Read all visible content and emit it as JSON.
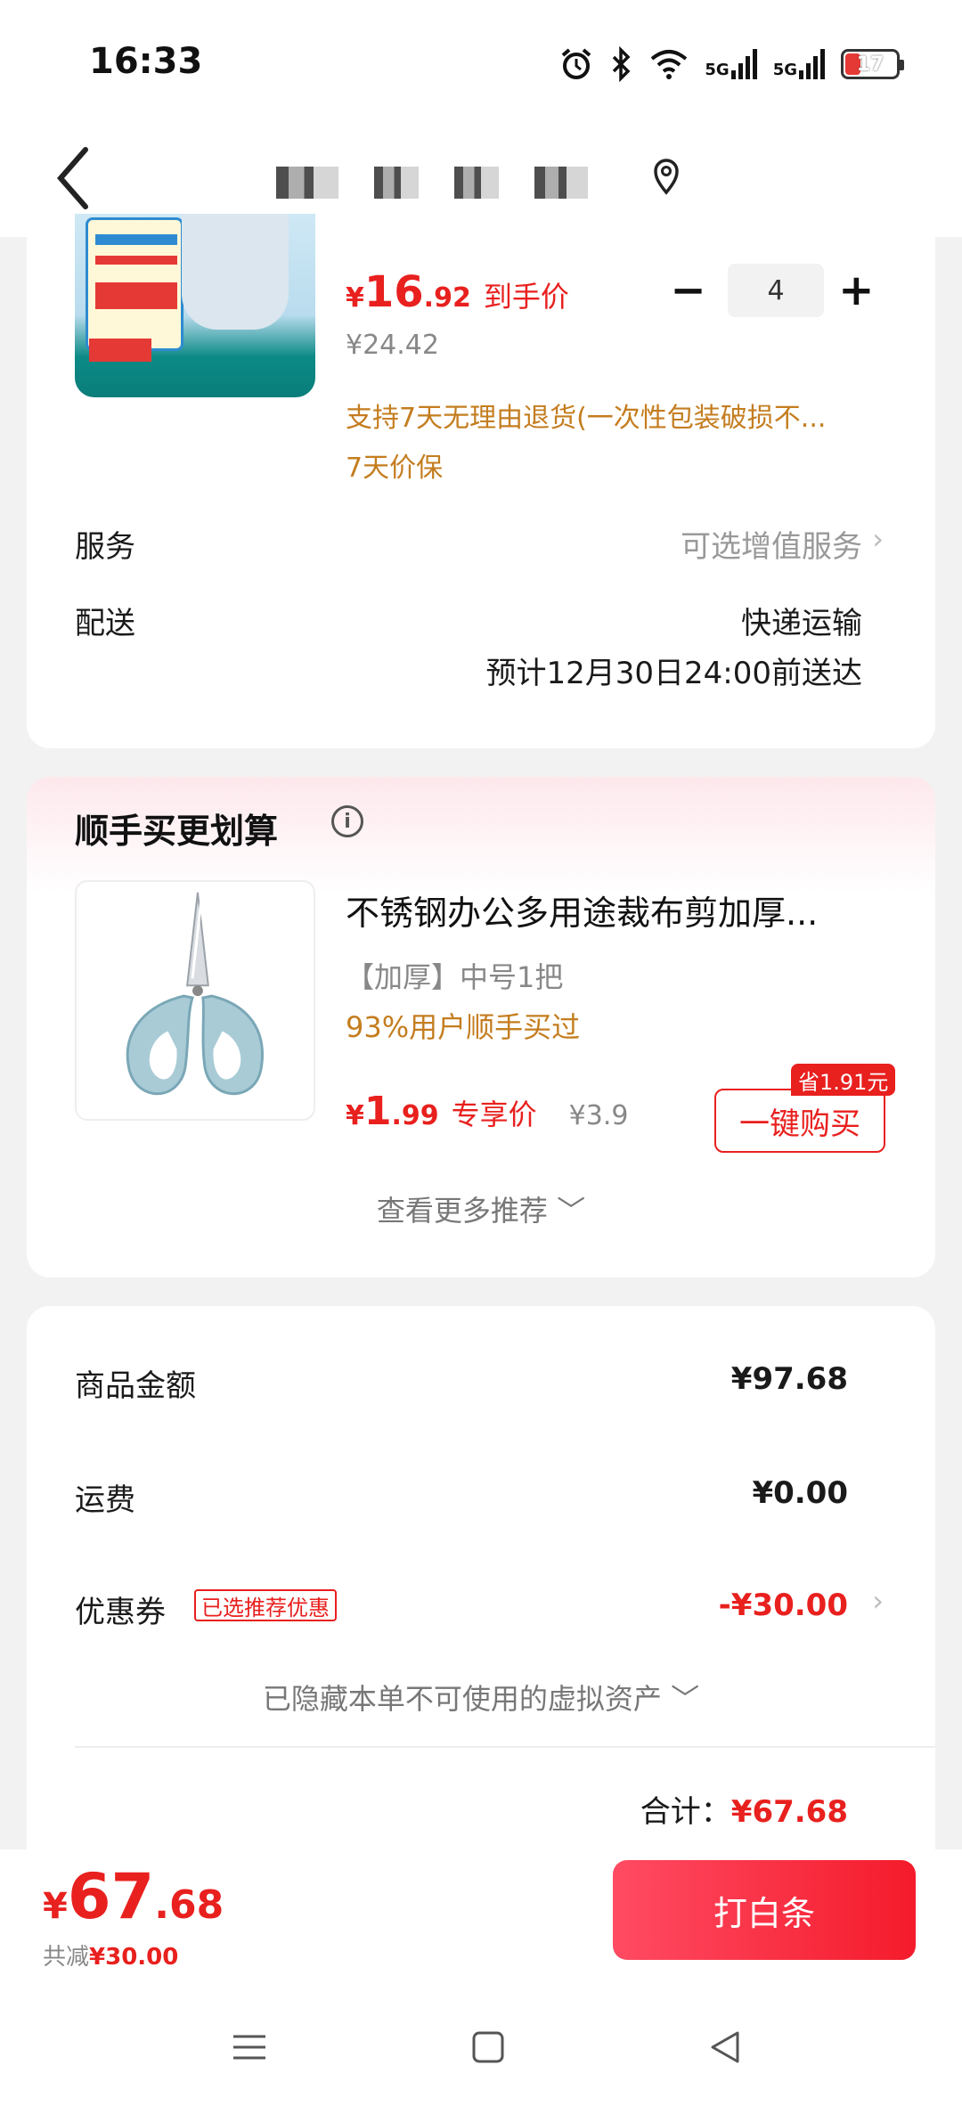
{
  "status_bar": {
    "time": "16:33",
    "network_1": "5G",
    "network_2": "5G",
    "battery": "17"
  },
  "nav": {
    "title": ""
  },
  "product": {
    "price_symbol": "¥",
    "price_int": "16",
    "price_dec": ".92",
    "price_tag": "到手价",
    "original_price": "¥24.42",
    "quantity": "4",
    "minus": "−",
    "plus": "+",
    "return_policy": "支持7天无理由退货(一次性包装破损不...",
    "price_protect": "7天价保"
  },
  "service": {
    "label": "服务",
    "value": "可选增值服务"
  },
  "delivery": {
    "label": "配送",
    "method": "快递运输",
    "eta": "预计12月30日24:00前送达"
  },
  "addon": {
    "title": "顺手买更划算",
    "info_icon": "i",
    "name": "不锈钢办公多用途裁布剪加厚...",
    "spec": "【加厚】中号1把",
    "social_proof": "93%用户顺手买过",
    "price_symbol": "¥",
    "price_int": "1",
    "price_dec": ".99",
    "price_tag": "专享价",
    "original_price": "¥3.9",
    "save_badge": "省1.91元",
    "buy_button": "一键购买",
    "more": "查看更多推荐 ﹀"
  },
  "summary": {
    "goods_label": "商品金额",
    "goods_value": "¥97.68",
    "shipping_label": "运费",
    "shipping_value": "¥0.00",
    "coupon_label": "优惠券",
    "coupon_tag": "已选推荐优惠",
    "coupon_value": "-¥30.00",
    "hidden_assets": "已隐藏本单不可使用的虚拟资产 ﹀",
    "total_label": "合计：",
    "total_value": "¥67.68"
  },
  "footer": {
    "price_symbol": "¥",
    "price_int": "67",
    "price_dec": ".68",
    "discount_label": "共减",
    "discount_value": "¥30.00",
    "pay_button": "打白条"
  },
  "colors": {
    "accent": "#e8201e",
    "promo": "#c47d1f",
    "background": "#f2f2f2"
  }
}
